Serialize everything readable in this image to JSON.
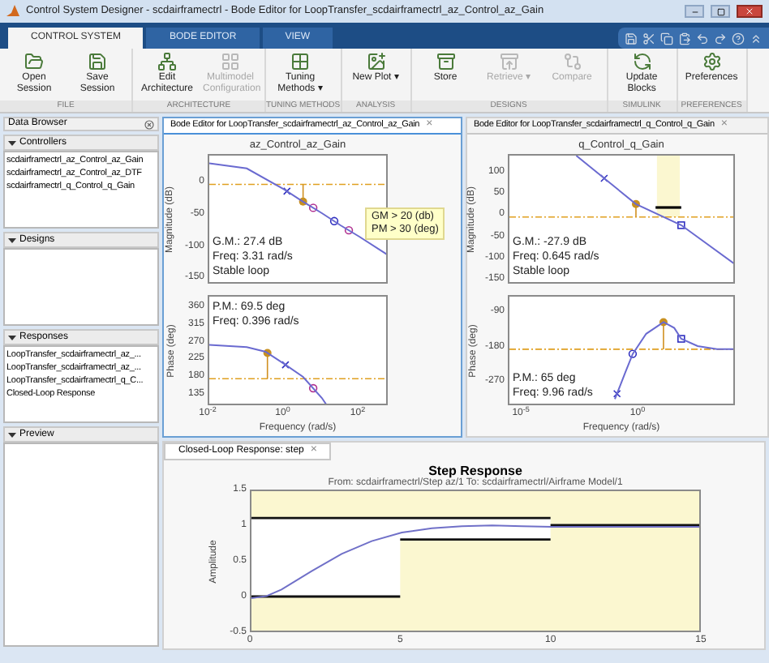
{
  "window": {
    "title": "Control System Designer - scdairframectrl - Bode Editor for LoopTransfer_scdairframectrl_az_Control_az_Gain"
  },
  "ribbon_tabs": [
    {
      "label": "CONTROL SYSTEM",
      "selected": true
    },
    {
      "label": "BODE EDITOR",
      "selected": false
    },
    {
      "label": "VIEW",
      "selected": false
    }
  ],
  "toolstrip": [
    {
      "label": "FILE",
      "buttons": [
        {
          "label": "Open Session",
          "disabled": false
        },
        {
          "label": "Save Session",
          "disabled": false
        }
      ]
    },
    {
      "label": "ARCHITECTURE",
      "buttons": [
        {
          "label": "Edit Architecture",
          "disabled": false
        },
        {
          "label": "Multimodel Configuration",
          "disabled": true
        }
      ]
    },
    {
      "label": "TUNING METHODS",
      "buttons": [
        {
          "label": "Tuning Methods",
          "glyph": "▾",
          "disabled": false
        }
      ]
    },
    {
      "label": "ANALYSIS",
      "buttons": [
        {
          "label": "New Plot",
          "glyph": "▾",
          "disabled": false
        }
      ]
    },
    {
      "label": "DESIGNS",
      "buttons": [
        {
          "label": "Store",
          "disabled": false
        },
        {
          "label": "Retrieve",
          "glyph": "▾",
          "disabled": true
        },
        {
          "label": "Compare",
          "disabled": true
        }
      ]
    },
    {
      "label": "SIMULINK",
      "buttons": [
        {
          "label": "Update Blocks",
          "disabled": false
        }
      ]
    },
    {
      "label": "PREFERENCES",
      "buttons": [
        {
          "label": "Preferences",
          "disabled": false
        }
      ]
    }
  ],
  "data_browser": {
    "title": "Data Browser",
    "sections": [
      {
        "title": "Controllers",
        "expanded": true,
        "items": [
          "scdairframectrl_az_Control_az_Gain",
          "scdairframectrl_az_Control_az_DTF",
          "scdairframectrl_q_Control_q_Gain"
        ]
      },
      {
        "title": "Designs",
        "expanded": true
      },
      {
        "title": "Responses",
        "expanded": true,
        "items": [
          "LoopTransfer_scdairframectrl_az_...",
          "LoopTransfer_scdairframectrl_az_...",
          "LoopTransfer_scdairframectrl_q_C...",
          "Closed-Loop Response"
        ]
      },
      {
        "title": "Preview",
        "expanded": true
      }
    ]
  },
  "bode_editors": [
    {
      "tab": "Bode Editor for LoopTransfer_scdairframectrl_az_Control_az_Gain",
      "close": "×",
      "selected": true,
      "magnitude": {
        "title": "az_Control_az_Gain",
        "ylabel": "Magnitude (dB)",
        "ytick_labels": [
          "0",
          "-50",
          "-100",
          "-150"
        ],
        "readout": [
          "G.M.: 27.4 dB",
          "Freq: 3.31 rad/s",
          "Stable loop"
        ],
        "requirement": [
          "GM > 20 (db)",
          "PM > 30 (deg)"
        ]
      },
      "phase": {
        "ylabel": "Phase (deg)",
        "ytick_labels": [
          "360",
          "315",
          "270",
          "225",
          "180",
          "135"
        ],
        "xtick_labels": [
          "10$^{-2}$",
          "10$^{0}$",
          "10$^{2}$"
        ],
        "xlabel": "Frequency (rad/s)",
        "readout": [
          "P.M.: 69.5 deg",
          "Freq: 0.396 rad/s"
        ]
      }
    },
    {
      "tab": "Bode Editor for LoopTransfer_scdairframectrl_q_Control_q_Gain",
      "close": "×",
      "selected": false,
      "magnitude": {
        "title": "q_Control_q_Gain",
        "ylabel": "Magnitude (dB)",
        "ytick_labels": [
          "100",
          "50",
          "0",
          "-50",
          "-100",
          "-150"
        ],
        "readout": [
          "G.M.: -27.9 dB",
          "Freq: 0.645 rad/s",
          "Stable loop"
        ]
      },
      "phase": {
        "ylabel": "Phase (deg)",
        "ytick_labels": [
          "-90",
          "-180",
          "-270"
        ],
        "xtick_labels": [
          "10$^{-5}$",
          "10$^{0}$"
        ],
        "xlabel": "Frequency (rad/s)",
        "readout": [
          "P.M.: 65 deg",
          "Freq: 9.96 rad/s"
        ]
      }
    }
  ],
  "step_response": {
    "tab": "Closed-Loop Response: step",
    "close": "×",
    "subtitle": "From: scdairframectrl/Step az/1  To: scdairframectrl/Airframe Model/1",
    "chart_data": {
      "type": "line",
      "title": "Step Response",
      "ylabel": "Amplitude",
      "x": [
        0,
        0.5,
        1,
        2,
        3,
        4,
        5,
        6,
        7,
        8,
        9,
        10,
        15
      ],
      "series": [
        {
          "color": "#7070c8",
          "values": [
            0,
            0.03,
            0.12,
            0.38,
            0.62,
            0.8,
            0.92,
            0.98,
            1.01,
            1.02,
            1.01,
            1,
            1
          ]
        }
      ],
      "xlim": [
        0,
        15
      ],
      "ylim": [
        -0.5,
        1.5
      ],
      "xticks": [
        0,
        5,
        10,
        15
      ],
      "yticks": [
        1.5,
        1,
        0.5,
        0,
        -0.5
      ]
    }
  }
}
